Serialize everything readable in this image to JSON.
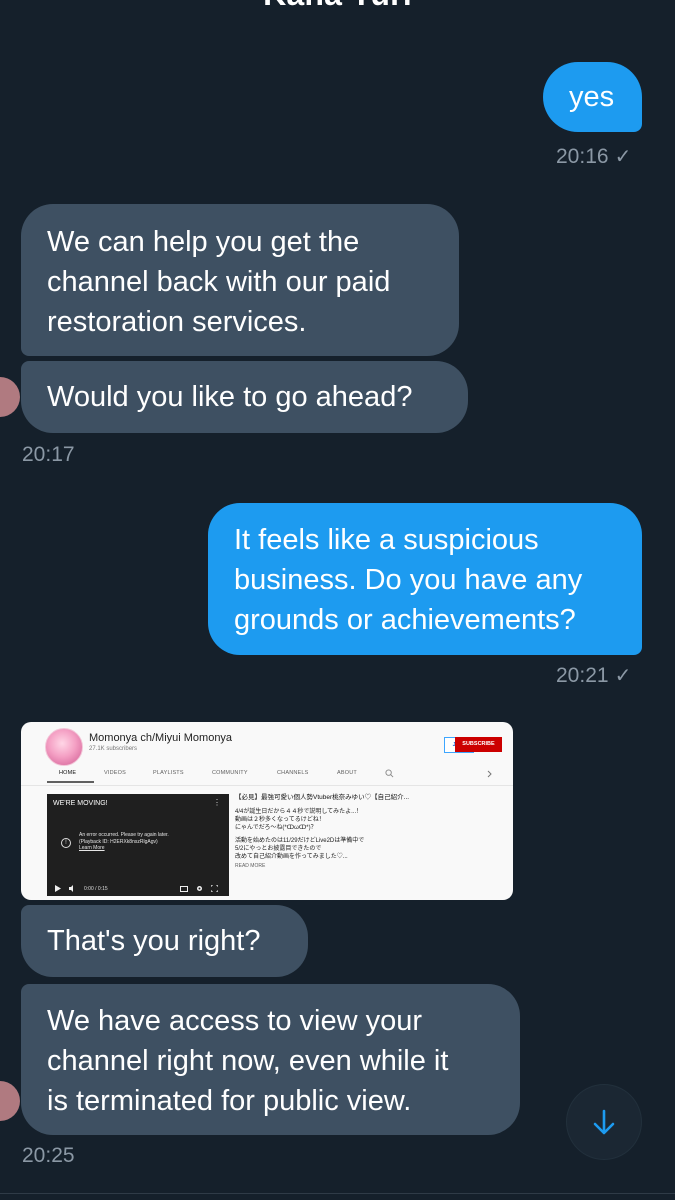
{
  "header": {
    "contact_name": "Kana Yuri"
  },
  "messages": [
    {
      "id": "m1",
      "direction": "out",
      "lines": [
        "yes"
      ],
      "time": "20:16"
    },
    {
      "id": "m2",
      "direction": "in",
      "lines": [
        "We can help you get the",
        "channel back with our paid",
        "restoration services."
      ]
    },
    {
      "id": "m3",
      "direction": "in",
      "lines": [
        "Would you like to go ahead?"
      ],
      "time": "20:17"
    },
    {
      "id": "m4",
      "direction": "out",
      "lines": [
        "It feels like a suspicious",
        "business. Do you have any",
        "grounds or achievements?"
      ],
      "time": "20:21"
    },
    {
      "id": "m5",
      "direction": "in",
      "lines": [
        "That's you right?"
      ]
    },
    {
      "id": "m6",
      "direction": "in",
      "lines": [
        "We have access to view your",
        "channel right now, even while it",
        "is terminated for public view."
      ],
      "time": "20:25"
    }
  ],
  "read_check": "✓",
  "attachment": {
    "channel_name": "Momonya ch/Miyui Momonya",
    "subscribers": "27.1K subscribers",
    "join_label": "JOIN",
    "subscribe_label": "SUBSCRIBE",
    "tabs": [
      "HOME",
      "VIDEOS",
      "PLAYLISTS",
      "COMMUNITY",
      "CHANNELS",
      "ABOUT"
    ],
    "player_title": "WE'RE MOVING!",
    "error_lines": [
      "An error occurred. Please try again later.",
      "(Playback ID: H2ERXk8nszRlgAgv)",
      "Learn More"
    ],
    "player_time": "0:00 / 0:15",
    "video_title": "【必見】最強可愛い個人勢Vtuber桃奈みゆい♡【自己紹介...",
    "description_lines": [
      "4/4が誕生日だから４４秒で説明してみたよ...！",
      "動画は２秒多くなってるけどね！",
      "にゃんでだろ～ね(*ↀωↀ*)？",
      "",
      "活動を始めたのは11/29だけどLive2Dは準備中で",
      "5/2にやっとお披露目できたので",
      "改めて自己紹介動画を作ってみました♡..."
    ],
    "read_more": "READ MORE"
  },
  "colors": {
    "background": "#15202b",
    "incoming_bubble": "#3e5062",
    "outgoing_bubble": "#1d9bf0",
    "timestamp": "#8b98a5",
    "subscribe_red": "#cc0000"
  },
  "icons": {
    "scroll_down": "arrow-down-icon"
  }
}
